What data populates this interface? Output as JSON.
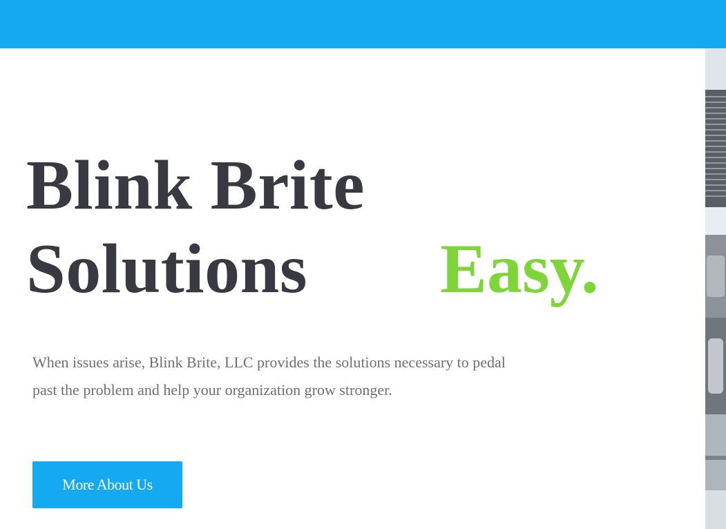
{
  "colors": {
    "brand_blue": "#15a9f1",
    "heading": "#393a41",
    "accent_green": "#7ed53a",
    "body_text": "#6e6f74",
    "button_text": "#ffffff",
    "background": "#ffffff"
  },
  "hero": {
    "title_line1": "Blink Brite",
    "title_line2": "Solutions",
    "accent": "Easy.",
    "description": "When issues arise, Blink Brite, LLC provides the solutions necessary to pedal past the problem and help your organization grow stronger.",
    "cta_label": "More About Us"
  }
}
